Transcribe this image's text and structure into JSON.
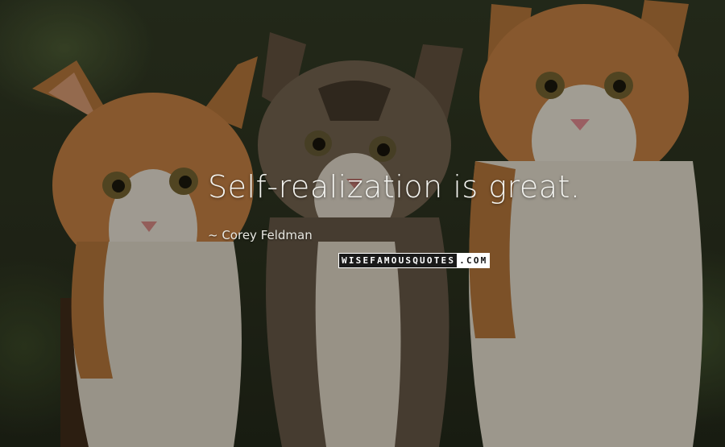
{
  "quote": {
    "text": "Self-realization is great.",
    "author": "~ Corey Feldman"
  },
  "watermark": {
    "left_text": "WISEFAMOUSQUOTES",
    "right_text": ".COM"
  },
  "background": {
    "subject": "three kittens",
    "colors": {
      "foliage": "#2c3420",
      "orange_fur": "#b7773d",
      "white_fur": "#d8d2c6",
      "tabby_fur": "#6a5a48"
    }
  }
}
